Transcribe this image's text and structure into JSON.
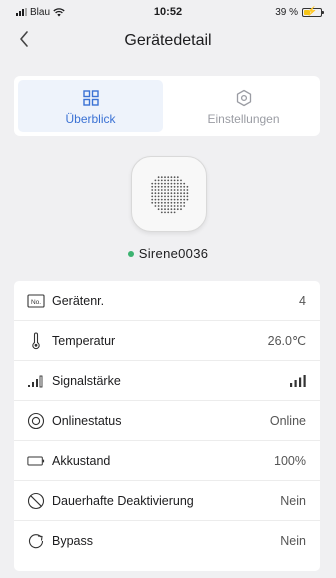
{
  "status_bar": {
    "carrier": "Blau",
    "time": "10:52",
    "battery": "39 %",
    "battery_level": 0.39
  },
  "nav": {
    "title": "Gerätedetail"
  },
  "tabs": [
    {
      "label": "Überblick",
      "active": true
    },
    {
      "label": "Einstellungen",
      "active": false
    }
  ],
  "device": {
    "name": "Sirene0036",
    "status_color": "#3cb371"
  },
  "rows": [
    {
      "label": "Gerätenr.",
      "value": "4",
      "icon": "number-icon"
    },
    {
      "label": "Temperatur",
      "value": "26.0℃",
      "icon": "thermometer-icon"
    },
    {
      "label": "Signalstärke",
      "value": "",
      "icon": "signal-strength-icon"
    },
    {
      "label": "Onlinestatus",
      "value": "Online",
      "icon": "online-status-icon"
    },
    {
      "label": "Akkustand",
      "value": "100%",
      "icon": "battery-icon"
    },
    {
      "label": "Dauerhafte Deaktivierung",
      "value": "Nein",
      "icon": "deactivate-icon"
    },
    {
      "label": "Bypass",
      "value": "Nein",
      "icon": "bypass-icon"
    }
  ],
  "colors": {
    "accent": "#3b72d4",
    "background": "#f0f0f2"
  }
}
